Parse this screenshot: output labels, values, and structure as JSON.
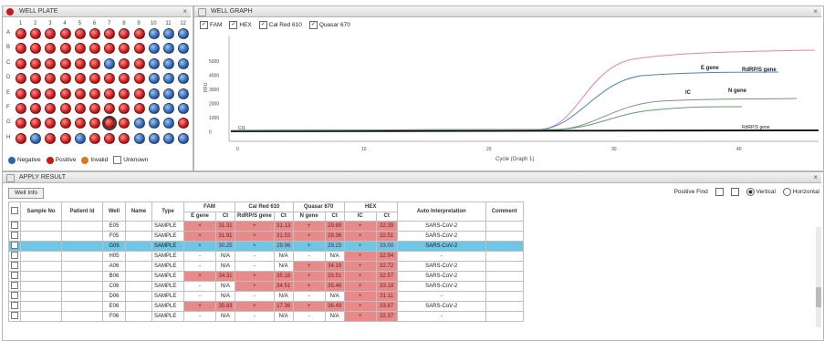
{
  "plate": {
    "title": "WELL PLATE",
    "close": "×",
    "columns": [
      "1",
      "2",
      "3",
      "4",
      "5",
      "6",
      "7",
      "8",
      "9",
      "10",
      "11",
      "12"
    ],
    "rows": [
      "A",
      "B",
      "C",
      "D",
      "E",
      "F",
      "G",
      "H"
    ],
    "wells": [
      [
        "pos",
        "pos",
        "pos",
        "pos",
        "pos",
        "pos",
        "pos",
        "pos",
        "pos",
        "neg",
        "neg",
        "neg"
      ],
      [
        "pos",
        "pos",
        "pos",
        "pos",
        "pos",
        "pos",
        "pos",
        "pos",
        "pos",
        "neg",
        "neg",
        "neg"
      ],
      [
        "pos",
        "pos",
        "pos",
        "pos",
        "pos",
        "pos",
        "neg",
        "pos",
        "pos",
        "neg",
        "neg",
        "neg"
      ],
      [
        "pos",
        "pos",
        "pos",
        "pos",
        "pos",
        "pos",
        "pos",
        "pos",
        "pos",
        "neg",
        "neg",
        "neg"
      ],
      [
        "pos",
        "pos",
        "pos",
        "pos",
        "pos",
        "pos",
        "pos",
        "pos",
        "pos",
        "neg",
        "neg",
        "neg"
      ],
      [
        "pos",
        "pos",
        "pos",
        "pos",
        "pos",
        "pos",
        "pos",
        "pos",
        "pos",
        "neg",
        "neg",
        "neg"
      ],
      [
        "pos",
        "pos",
        "pos",
        "pos",
        "pos",
        "pos",
        "pos",
        "pos",
        "neg",
        "neg",
        "neg",
        "pos"
      ],
      [
        "pos",
        "neg",
        "pos",
        "pos",
        "neg",
        "pos",
        "pos",
        "pos",
        "neg",
        "neg",
        "neg",
        "neg"
      ]
    ],
    "selected_well": "G7",
    "legend": {
      "negative": "Negative",
      "positive": "Positive",
      "invalid": "Invalid",
      "unknown": "Unknown"
    },
    "colors": {
      "positive": "#c81818",
      "negative": "#2f63b0",
      "invalid": "#d77b1a"
    }
  },
  "graph": {
    "title": "WELL GRAPH",
    "close": "×",
    "checks": [
      {
        "label": "FAM",
        "checked": true
      },
      {
        "label": "HEX",
        "checked": true
      },
      {
        "label": "Cal Red 610",
        "checked": true
      },
      {
        "label": "Quasar 670",
        "checked": true
      }
    ],
    "ylabel": "RFU",
    "yticks": [
      "5000",
      "4000",
      "3000",
      "2000",
      "1000",
      "0"
    ],
    "xticks": [
      "0",
      "10",
      "20",
      "30",
      "40"
    ],
    "xlabel": "Cycle (Graph 1)",
    "annotations": [
      "E gene",
      "RdRP/S gene",
      "N gene",
      "IC",
      "RdRP/S gene"
    ],
    "bottom_label": "Ct1"
  },
  "result": {
    "title": "APPLY RESULT",
    "close": "×",
    "tab": "Well Info",
    "positive_find": "Positive Find",
    "vertical": "Vertical",
    "horizontal": "Horizontal",
    "headers_top": [
      "Sample No",
      "Patient Id",
      "Well",
      "Name",
      "Type",
      "FAM",
      "Cal Red 610",
      "Quasar 670",
      "HEX",
      "Auto Interpretation",
      "Comment"
    ],
    "headers_sub": [
      "E gene",
      "Ct",
      "RdRP/S gene",
      "Ct",
      "N gene",
      "Ct",
      "IC",
      "Ct"
    ],
    "rows": [
      {
        "well": "E05",
        "type": "SAMPLE",
        "e": "+",
        "e_ct": "31.31",
        "r": "+",
        "r_ct": "31.13",
        "n": "+",
        "n_ct": "29.89",
        "ic": "+",
        "ic_ct": "32.39",
        "interp": "SARS-CoV-2",
        "sel": false
      },
      {
        "well": "F05",
        "type": "SAMPLE",
        "e": "+",
        "e_ct": "31.91",
        "r": "+",
        "r_ct": "31.53",
        "n": "+",
        "n_ct": "29.36",
        "ic": "+",
        "ic_ct": "32.51",
        "interp": "SARS-CoV-2",
        "sel": false
      },
      {
        "well": "G05",
        "type": "SAMPLE",
        "e": "+",
        "e_ct": "30.25",
        "r": "+",
        "r_ct": "29.96",
        "n": "+",
        "n_ct": "29.23",
        "ic": "+",
        "ic_ct": "33.00",
        "interp": "SARS-CoV-2",
        "sel": true
      },
      {
        "well": "H05",
        "type": "SAMPLE",
        "e": "-",
        "e_ct": "N/A",
        "r": "-",
        "r_ct": "N/A",
        "n": "-",
        "n_ct": "N/A",
        "ic": "+",
        "ic_ct": "32.94",
        "interp": "-",
        "sel": false
      },
      {
        "well": "A06",
        "type": "SAMPLE",
        "e": "-",
        "e_ct": "N/A",
        "r": "-",
        "r_ct": "N/A",
        "n": "+",
        "n_ct": "34.19",
        "ic": "+",
        "ic_ct": "32.72",
        "interp": "SARS-CoV-2",
        "sel": false
      },
      {
        "well": "B06",
        "type": "SAMPLE",
        "e": "+",
        "e_ct": "34.31",
        "r": "+",
        "r_ct": "35.18",
        "n": "+",
        "n_ct": "33.51",
        "ic": "+",
        "ic_ct": "32.57",
        "interp": "SARS-CoV-2",
        "sel": false
      },
      {
        "well": "C06",
        "type": "SAMPLE",
        "e": "-",
        "e_ct": "N/A",
        "r": "+",
        "r_ct": "34.51",
        "n": "+",
        "n_ct": "35.46",
        "ic": "+",
        "ic_ct": "33.18",
        "interp": "SARS-CoV-2",
        "sel": false
      },
      {
        "well": "D06",
        "type": "SAMPLE",
        "e": "-",
        "e_ct": "N/A",
        "r": "-",
        "r_ct": "N/A",
        "n": "-",
        "n_ct": "N/A",
        "ic": "+",
        "ic_ct": "31.11",
        "interp": "-",
        "sel": false
      },
      {
        "well": "E06",
        "type": "SAMPLE",
        "e": "+",
        "e_ct": "35.83",
        "r": "+",
        "r_ct": "17.36",
        "n": "+",
        "n_ct": "36.49",
        "ic": "+",
        "ic_ct": "33.87",
        "interp": "SARS-CoV-2",
        "sel": false
      },
      {
        "well": "F06",
        "type": "SAMPLE",
        "e": "-",
        "e_ct": "N/A",
        "r": "-",
        "r_ct": "N/A",
        "n": "-",
        "n_ct": "N/A",
        "ic": "+",
        "ic_ct": "32.37",
        "interp": "-",
        "sel": false
      }
    ]
  }
}
